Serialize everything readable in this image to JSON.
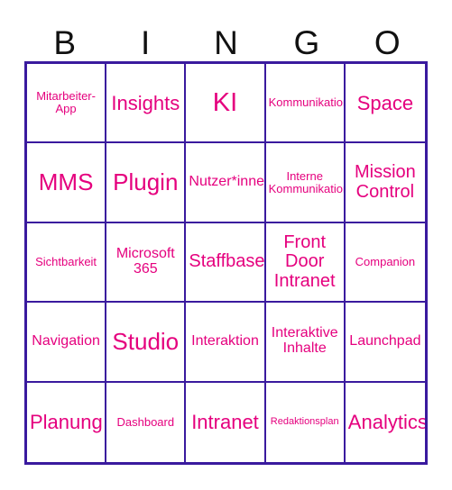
{
  "card": {
    "title": "BINGO",
    "header_letters": [
      "B",
      "I",
      "N",
      "G",
      "O"
    ],
    "accent_text_color": "#E5007E",
    "grid_border_color": "#3A1A9E",
    "header_text_color": "#111111",
    "background_color": "#FFFFFF",
    "rows": 5,
    "columns": 5,
    "cells": [
      {
        "text": "Mitarbeiter-App",
        "size": "t-xs"
      },
      {
        "text": "Insights",
        "size": "t-lg"
      },
      {
        "text": "KI",
        "size": "t-xxl"
      },
      {
        "text": "Kommunikation",
        "size": "t-xs"
      },
      {
        "text": "Space",
        "size": "t-lg"
      },
      {
        "text": "MMS",
        "size": "t-xl"
      },
      {
        "text": "Plugin",
        "size": "t-xl"
      },
      {
        "text": "Nutzer*innen",
        "size": "t-sm"
      },
      {
        "text": "Interne Kommunikation",
        "size": "t-xs"
      },
      {
        "text": "Mission Control",
        "size": "t-md"
      },
      {
        "text": "Sichtbarkeit",
        "size": "t-xs"
      },
      {
        "text": "Microsoft 365",
        "size": "t-sm"
      },
      {
        "text": "Staffbase",
        "size": "t-md"
      },
      {
        "text": "Front Door Intranet",
        "size": "t-md"
      },
      {
        "text": "Companion",
        "size": "t-xs"
      },
      {
        "text": "Navigation",
        "size": "t-sm"
      },
      {
        "text": "Studio",
        "size": "t-xl"
      },
      {
        "text": "Interaktion",
        "size": "t-sm"
      },
      {
        "text": "Interaktive Inhalte",
        "size": "t-sm"
      },
      {
        "text": "Launchpad",
        "size": "t-sm"
      },
      {
        "text": "Planung",
        "size": "t-lg"
      },
      {
        "text": "Dashboard",
        "size": "t-xs"
      },
      {
        "text": "Intranet",
        "size": "t-lg"
      },
      {
        "text": "Redaktionsplan",
        "size": "t-xxs"
      },
      {
        "text": "Analytics",
        "size": "t-lg"
      }
    ]
  }
}
